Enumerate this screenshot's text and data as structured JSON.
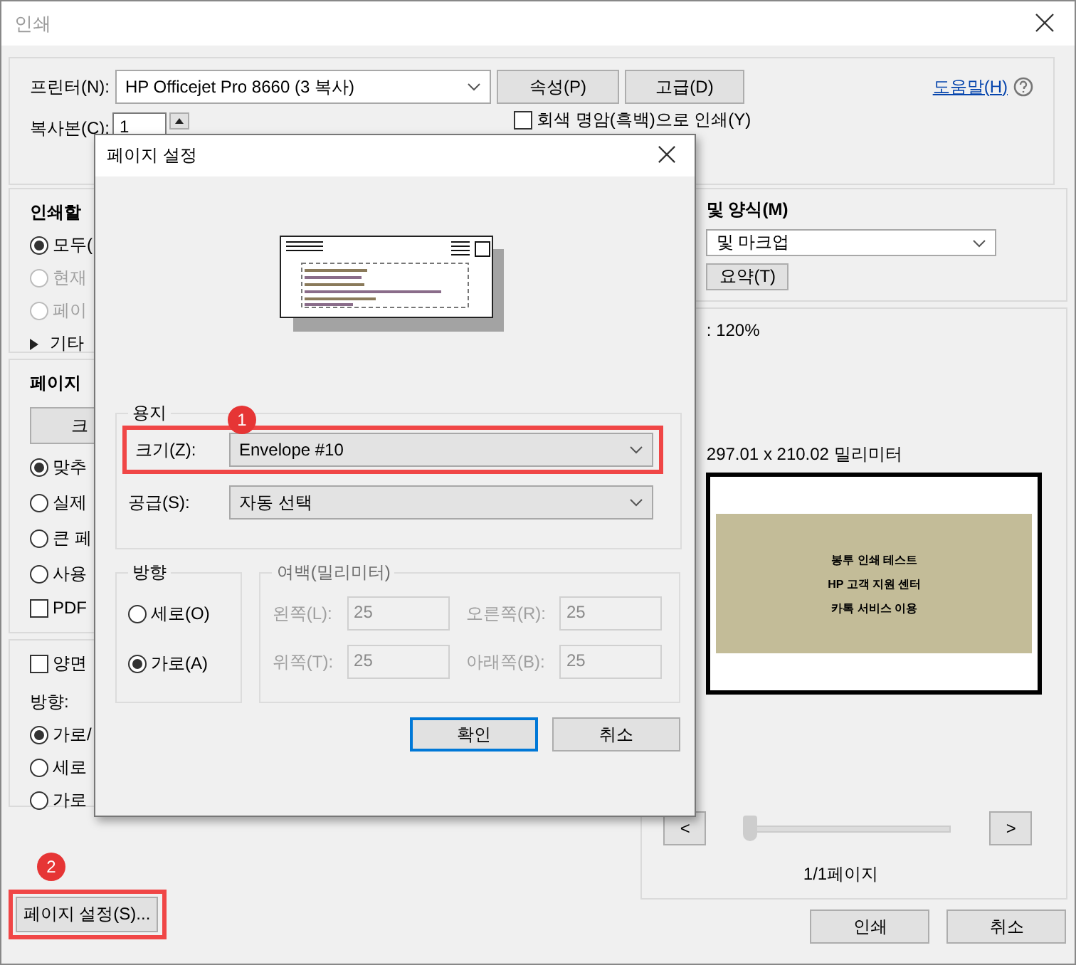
{
  "window": {
    "title": "인쇄"
  },
  "printer": {
    "label": "프린터(N):",
    "value": "HP Officejet Pro 8660 (3 복사)",
    "buttons": [
      "속성(P)",
      "고급(D)"
    ],
    "help": "도움말(H)"
  },
  "copies": {
    "label": "복사본(C):",
    "value": "1"
  },
  "grayscale": {
    "label": "회색 명암(흑백)으로 인쇄(Y)",
    "checked": false
  },
  "pages_section": {
    "title": "인쇄할",
    "options": [
      {
        "label": "모두(",
        "selected": true,
        "disabled": false
      },
      {
        "label": "현재",
        "selected": false,
        "disabled": true
      },
      {
        "label": "페이",
        "selected": false,
        "disabled": true
      }
    ],
    "more": "기타"
  },
  "size_section": {
    "title": "페이지",
    "button": "크",
    "options": [
      {
        "label": "맞추",
        "selected": true
      },
      {
        "label": "실제",
        "selected": false
      },
      {
        "label": "큰 페",
        "selected": false
      },
      {
        "label": "사용",
        "selected": false
      }
    ],
    "pdf": {
      "label": "PDF",
      "checked": false
    }
  },
  "orient_section": {
    "duplex": {
      "label": "양면",
      "checked": false
    },
    "title": "방향:",
    "options": [
      {
        "label": "가로/",
        "selected": true
      },
      {
        "label": "세로",
        "selected": false
      },
      {
        "label": "가로",
        "selected": false
      }
    ]
  },
  "page_setup_button": {
    "label": "페이지 설정(S)...",
    "badge": "2"
  },
  "comments": {
    "title": "및 양식(M)",
    "value": "및 마크업",
    "button": "요약(T)"
  },
  "preview": {
    "scale": ": 120%",
    "dimensions": "297.01 x 210.02 밀리미터",
    "lines": [
      "봉투 인쇄 테스트",
      "HP 고객 지원 센터",
      "카톡 서비스 이용"
    ],
    "prev": "<",
    "next": ">",
    "slider": {
      "level": 0
    },
    "page": "1/1페이지"
  },
  "buttons": [
    "인쇄",
    "취소"
  ],
  "dialog": {
    "title": "페이지 설정",
    "paper": {
      "title": "용지",
      "badge": "1",
      "size_label": "크기(Z):",
      "size": "Envelope #10",
      "source_label": "공급(S):",
      "source": "자동 선택"
    },
    "orientation": {
      "title": "방향",
      "options": [
        {
          "label": "세로(O)",
          "selected": false
        },
        {
          "label": "가로(A)",
          "selected": true
        }
      ]
    },
    "margins": {
      "title": "여백(밀리미터)",
      "disabled": true,
      "fields": [
        {
          "label": "왼쪽(L):",
          "value": "25"
        },
        {
          "label": "오른쪽(R):",
          "value": "25"
        },
        {
          "label": "위쪽(T):",
          "value": "25"
        },
        {
          "label": "아래쪽(B):",
          "value": "25"
        }
      ]
    },
    "buttons": [
      {
        "label": "확인",
        "default": true
      },
      {
        "label": "취소",
        "default": false
      }
    ]
  }
}
